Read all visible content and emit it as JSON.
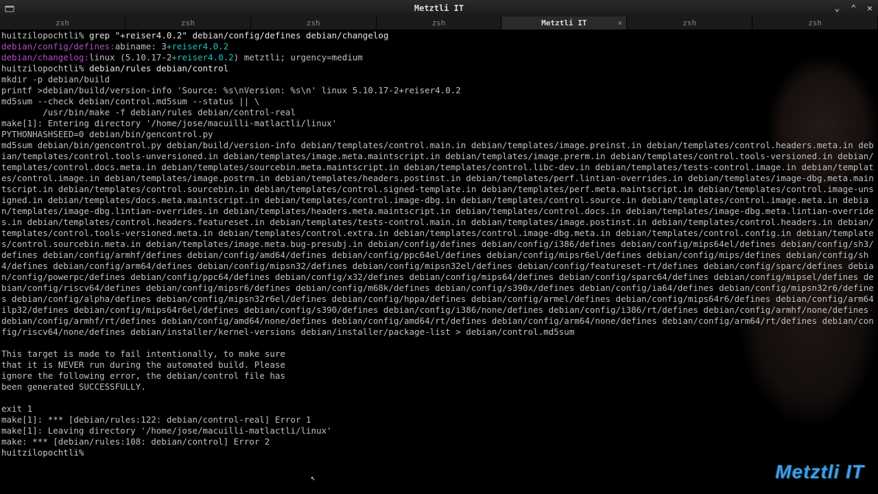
{
  "window": {
    "title": "Metztli IT"
  },
  "tabs": [
    {
      "label": "zsh",
      "active": false
    },
    {
      "label": "zsh",
      "active": false
    },
    {
      "label": "zsh",
      "active": false
    },
    {
      "label": "zsh",
      "active": false
    },
    {
      "label": "Metztli IT",
      "active": true
    },
    {
      "label": "zsh",
      "active": false
    },
    {
      "label": "zsh",
      "active": false
    }
  ],
  "term": {
    "prompt1_host": "huitzilopochtli% ",
    "prompt1_cmd": "grep \"+reiser4.0.2\" debian/config/defines debian/changelog",
    "line2_path": "debian/config/defines:",
    "line2_key": "abiname: 3",
    "line2_hl": "+reiser4.0.2",
    "line3_path": "debian/changelog:",
    "line3_a": "linux (5.10.17-2",
    "line3_hl": "+reiser4.0.2",
    "line3_b": ") metztli; urgency=medium",
    "prompt2_host": "huitzilopochtli% ",
    "prompt2_cmd": "debian/rules debian/control",
    "mkdir": "mkdir -p debian/build",
    "printf": "printf >debian/build/version-info 'Source: %s\\nVersion: %s\\n' linux 5.10.17-2+reiser4.0.2",
    "md5check": "md5sum --check debian/control.md5sum --status || \\",
    "makefline": "        /usr/bin/make -f debian/rules debian/control-real",
    "enter": "make[1]: Entering directory '/home/jose/macuilli-matlactli/linux'",
    "pyhash": "PYTHONHASHSEED=0 debian/bin/gencontrol.py",
    "md5block": "md5sum debian/bin/gencontrol.py debian/build/version-info debian/templates/control.main.in debian/templates/image.preinst.in debian/templates/control.headers.meta.in debian/templates/control.tools-unversioned.in debian/templates/image.meta.maintscript.in debian/templates/image.prerm.in debian/templates/control.tools-versioned.in debian/templates/control.docs.meta.in debian/templates/sourcebin.meta.maintscript.in debian/templates/control.libc-dev.in debian/templates/tests-control.image.in debian/templates/control.image.in debian/templates/image.postrm.in debian/templates/headers.postinst.in debian/templates/perf.lintian-overrides.in debian/templates/image-dbg.meta.maintscript.in debian/templates/control.sourcebin.in debian/templates/control.signed-template.in debian/templates/perf.meta.maintscript.in debian/templates/control.image-unsigned.in debian/templates/docs.meta.maintscript.in debian/templates/control.image-dbg.in debian/templates/control.source.in debian/templates/control.image.meta.in debian/templates/image-dbg.lintian-overrides.in debian/templates/headers.meta.maintscript.in debian/templates/control.docs.in debian/templates/image-dbg.meta.lintian-overrides.in debian/templates/control.headers.featureset.in debian/templates/tests-control.main.in debian/templates/image.postinst.in debian/templates/control.headers.in debian/templates/control.tools-versioned.meta.in debian/templates/control.extra.in debian/templates/control.image-dbg.meta.in debian/templates/control.config.in debian/templates/control.sourcebin.meta.in debian/templates/image.meta.bug-presubj.in debian/config/defines debian/config/i386/defines debian/config/mips64el/defines debian/config/sh3/defines debian/config/armhf/defines debian/config/amd64/defines debian/config/ppc64el/defines debian/config/mipsr6el/defines debian/config/mips/defines debian/config/sh4/defines debian/config/arm64/defines debian/config/mipsn32/defines debian/config/mipsn32el/defines debian/config/featureset-rt/defines debian/config/sparc/defines debian/config/powerpc/defines debian/config/ppc64/defines debian/config/x32/defines debian/config/mips64/defines debian/config/sparc64/defines debian/config/mipsel/defines debian/config/riscv64/defines debian/config/mipsr6/defines debian/config/m68k/defines debian/config/s390x/defines debian/config/ia64/defines debian/config/mipsn32r6/defines debian/config/alpha/defines debian/config/mipsn32r6el/defines debian/config/hppa/defines debian/config/armel/defines debian/config/mips64r6/defines debian/config/arm64ilp32/defines debian/config/mips64r6el/defines debian/config/s390/defines debian/config/i386/none/defines debian/config/i386/rt/defines debian/config/armhf/none/defines debian/config/armhf/rt/defines debian/config/amd64/none/defines debian/config/amd64/rt/defines debian/config/arm64/none/defines debian/config/arm64/rt/defines debian/config/riscv64/none/defines debian/installer/kernel-versions debian/installer/package-list > debian/control.md5sum",
    "msg1": "This target is made to fail intentionally, to make sure",
    "msg2": "that it is NEVER run during the automated build. Please",
    "msg3": "ignore the following error, the debian/control file has",
    "msg4": "been generated SUCCESSFULLY.",
    "exit1": "exit 1",
    "err1": "make[1]: *** [debian/rules:122: debian/control-real] Error 1",
    "leave": "make[1]: Leaving directory '/home/jose/macuilli-matlactli/linux'",
    "err2": "make: *** [debian/rules:108: debian/control] Error 2",
    "prompt3": "huitzilopochtli% "
  },
  "watermark": "Metztli IT"
}
